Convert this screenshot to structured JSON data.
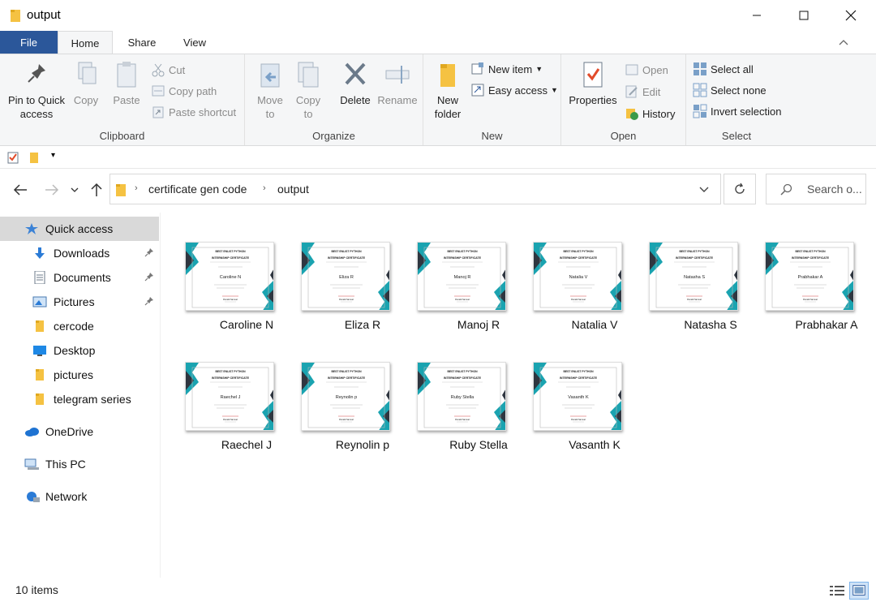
{
  "window": {
    "title": "output"
  },
  "tabs": {
    "file": "File",
    "home": "Home",
    "share": "Share",
    "view": "View"
  },
  "ribbon": {
    "clipboard": {
      "label": "Clipboard",
      "pin": "Pin to Quick access",
      "copy": "Copy",
      "paste": "Paste",
      "cut": "Cut",
      "copy_path": "Copy path",
      "paste_shortcut": "Paste shortcut"
    },
    "organize": {
      "label": "Organize",
      "move_to": "Move to",
      "copy_to": "Copy to",
      "delete": "Delete",
      "rename": "Rename"
    },
    "new": {
      "label": "New",
      "new_folder": "New folder",
      "new_item": "New item",
      "easy_access": "Easy access"
    },
    "open": {
      "label": "Open",
      "properties": "Properties",
      "open": "Open",
      "edit": "Edit",
      "history": "History"
    },
    "select": {
      "label": "Select",
      "select_all": "Select all",
      "select_none": "Select none",
      "invert": "Invert selection"
    }
  },
  "address": {
    "crumbs": [
      "certificate gen code",
      "output"
    ],
    "search_placeholder": "Search o..."
  },
  "sidebar": {
    "items": [
      {
        "label": "Quick access",
        "icon": "star-icon",
        "pinned": false
      },
      {
        "label": "Downloads",
        "icon": "download-icon",
        "pinned": true
      },
      {
        "label": "Documents",
        "icon": "document-icon",
        "pinned": true
      },
      {
        "label": "Pictures",
        "icon": "pictures-icon",
        "pinned": true
      },
      {
        "label": "cercode",
        "icon": "folder-icon",
        "pinned": false
      },
      {
        "label": "Desktop",
        "icon": "desktop-icon",
        "pinned": false
      },
      {
        "label": "pictures",
        "icon": "folder-icon",
        "pinned": false
      },
      {
        "label": "telegram series",
        "icon": "folder-icon",
        "pinned": false
      },
      {
        "label": "OneDrive",
        "icon": "cloud-icon",
        "pinned": false
      },
      {
        "label": "This PC",
        "icon": "pc-icon",
        "pinned": false
      },
      {
        "label": "Network",
        "icon": "network-icon",
        "pinned": false
      }
    ]
  },
  "certificate": {
    "school": "BEST ENLIST PYTHON",
    "heading": "INTERNSHIP CERTIFICATE",
    "signature": "Ronald Samuel"
  },
  "files": [
    {
      "name": "Caroline N"
    },
    {
      "name": "Eliza R"
    },
    {
      "name": "Manoj R"
    },
    {
      "name": "Natalia V"
    },
    {
      "name": "Natasha S"
    },
    {
      "name": "Prabhakar A"
    },
    {
      "name": "Raechel J"
    },
    {
      "name": "Reynolin p"
    },
    {
      "name": "Ruby Stella"
    },
    {
      "name": "Vasanth K"
    }
  ],
  "status": {
    "count": "10 items"
  },
  "colors": {
    "accent": "#2b579a",
    "teal": "#1aa3b0",
    "dark": "#2f3640",
    "folder": "#f5c242"
  }
}
